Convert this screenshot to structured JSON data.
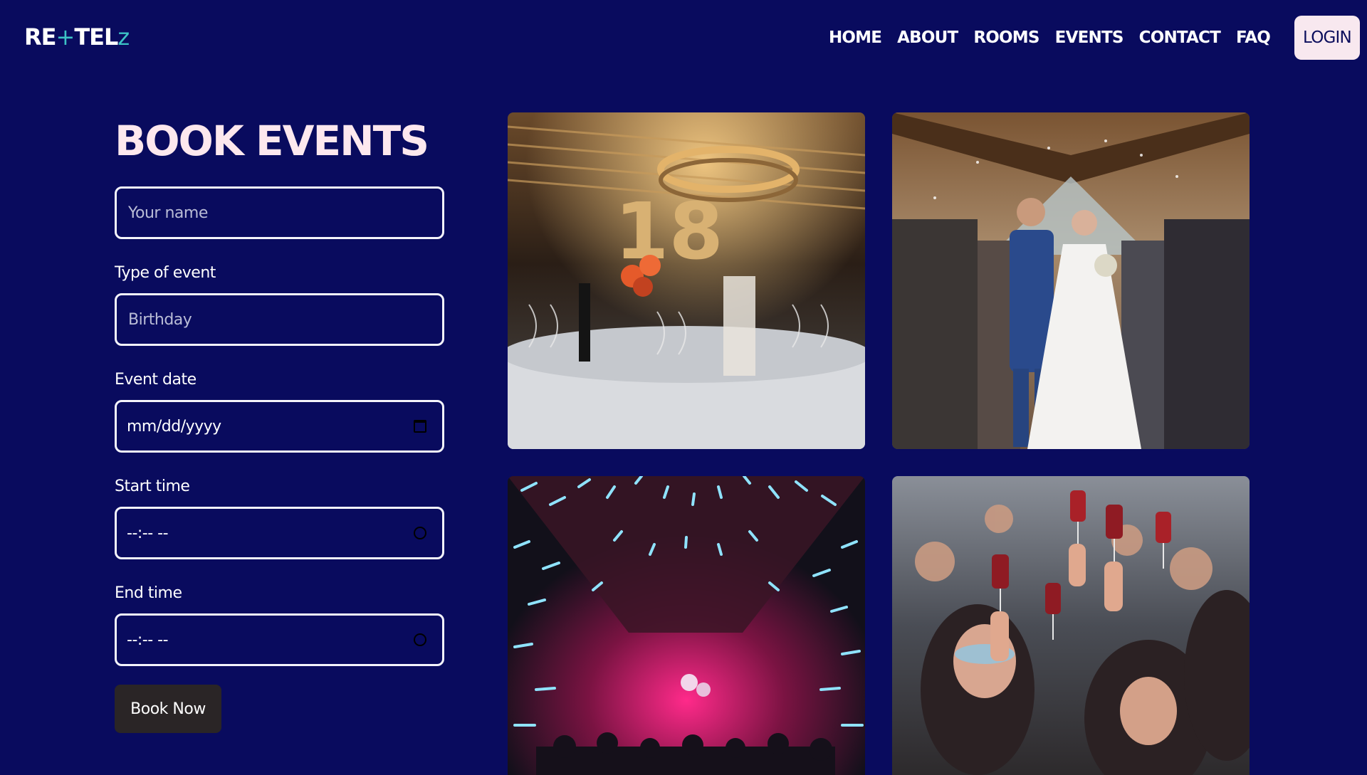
{
  "header": {
    "logo": {
      "part1": "RE",
      "plus": "+",
      "part2": "TEL",
      "z": "z"
    },
    "nav": [
      "HOME",
      "ABOUT",
      "ROOMS",
      "EVENTS",
      "CONTACT",
      "FAQ"
    ],
    "login_label": "LOGIN"
  },
  "form": {
    "title": "BOOK EVENTS",
    "name_placeholder": "Your name",
    "event_type_label": "Type of event",
    "event_type_placeholder": "Birthday",
    "date_label": "Event date",
    "date_value": "mm/dd/yyyy",
    "start_label": "Start time",
    "start_value": "--:-- --",
    "end_label": "End time",
    "end_value": "--:-- --",
    "submit_label": "Book Now"
  },
  "gallery": {
    "photos": [
      "birthday-18-table-photo",
      "wedding-couple-photo",
      "neon-club-hall-photo",
      "masquerade-party-toast-photo"
    ]
  },
  "colors": {
    "background": "#090b5e",
    "title": "#fde8ee",
    "login_bg": "#f8e8ef",
    "button_bg": "#2a2526",
    "accent": "#3cc2c5"
  }
}
